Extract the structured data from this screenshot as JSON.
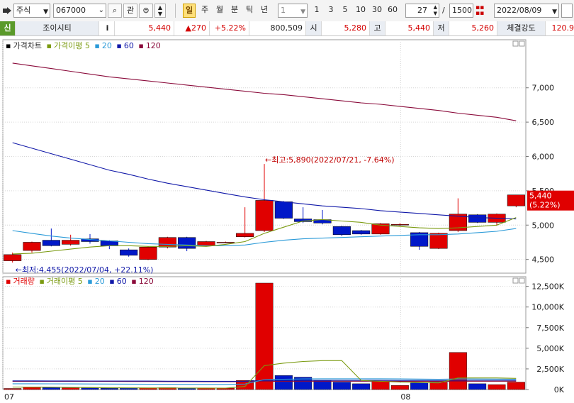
{
  "toolbar": {
    "market_select": "주식",
    "code_input": "067000",
    "btn_watch": "관",
    "period_buttons": [
      "일",
      "주",
      "월",
      "분",
      "틱",
      "년"
    ],
    "active_period": "일",
    "interval_select": "1",
    "intervals": [
      "1",
      "3",
      "5",
      "10",
      "30",
      "60"
    ],
    "count_current": "27",
    "count_sep": "/",
    "count_total": "1500",
    "date_input": "2022/08/09"
  },
  "quote": {
    "badge": "신",
    "name": "조이시티",
    "info_icon": "i",
    "price": "5,440",
    "change": "▲270",
    "change_pct": "+5.22%",
    "volume": "800,509",
    "open_label": "시",
    "open": "5,280",
    "high_label": "고",
    "high": "5,440",
    "low_label": "저",
    "low": "5,260",
    "strength_label": "체결강도",
    "strength": "120.9"
  },
  "colors": {
    "up": "#e00000",
    "down": "#0018c8",
    "ma5": "#7a9a10",
    "ma20": "#2a9ad8",
    "ma60": "#1018a8",
    "ma120": "#8a0a3a"
  },
  "chart_data": [
    {
      "type": "candlestick",
      "title": "가격차트",
      "legend": [
        "가격이평 5",
        "20",
        "60",
        "120"
      ],
      "x_tick_labels": [
        "07",
        "08"
      ],
      "ylim": [
        4300,
        7700
      ],
      "y_ticks": [
        "4,500",
        "5,000",
        "5,500",
        "6,000",
        "6,500",
        "7,000"
      ],
      "candles": [
        {
          "o": 4480,
          "c": 4570,
          "h": 4600,
          "l": 4455
        },
        {
          "o": 4630,
          "c": 4750,
          "h": 4760,
          "l": 4600
        },
        {
          "o": 4780,
          "c": 4700,
          "h": 4950,
          "l": 4690
        },
        {
          "o": 4720,
          "c": 4780,
          "h": 4860,
          "l": 4700
        },
        {
          "o": 4800,
          "c": 4760,
          "h": 4870,
          "l": 4730
        },
        {
          "o": 4770,
          "c": 4700,
          "h": 4780,
          "l": 4650
        },
        {
          "o": 4640,
          "c": 4560,
          "h": 4660,
          "l": 4540
        },
        {
          "o": 4500,
          "c": 4680,
          "h": 4690,
          "l": 4490
        },
        {
          "o": 4680,
          "c": 4820,
          "h": 4830,
          "l": 4660
        },
        {
          "o": 4820,
          "c": 4660,
          "h": 4830,
          "l": 4620
        },
        {
          "o": 4700,
          "c": 4760,
          "h": 4770,
          "l": 4690
        },
        {
          "o": 4750,
          "c": 4750,
          "h": 4760,
          "l": 4740
        },
        {
          "o": 4830,
          "c": 4880,
          "h": 5260,
          "l": 4820
        },
        {
          "o": 4920,
          "c": 5360,
          "h": 5890,
          "l": 4900
        },
        {
          "o": 5340,
          "c": 5100,
          "h": 5350,
          "l": 5090
        },
        {
          "o": 5090,
          "c": 5050,
          "h": 5260,
          "l": 5030
        },
        {
          "o": 5080,
          "c": 5030,
          "h": 5220,
          "l": 5010
        },
        {
          "o": 4980,
          "c": 4860,
          "h": 4990,
          "l": 4840
        },
        {
          "o": 4920,
          "c": 4870,
          "h": 4930,
          "l": 4860
        },
        {
          "o": 4870,
          "c": 5020,
          "h": 5030,
          "l": 4860
        },
        {
          "o": 5010,
          "c": 5010,
          "h": 5030,
          "l": 4990
        },
        {
          "o": 4890,
          "c": 4690,
          "h": 4900,
          "l": 4640
        },
        {
          "o": 4660,
          "c": 4880,
          "h": 4890,
          "l": 4650
        },
        {
          "o": 4920,
          "c": 5160,
          "h": 5390,
          "l": 4900
        },
        {
          "o": 5150,
          "c": 5040,
          "h": 5160,
          "l": 5030
        },
        {
          "o": 5040,
          "c": 5160,
          "h": 5170,
          "l": 4990
        },
        {
          "o": 5280,
          "c": 5440,
          "h": 5440,
          "l": 5260
        }
      ],
      "ma5": [
        4580,
        4590,
        4620,
        4650,
        4680,
        4700,
        4700,
        4690,
        4690,
        4700,
        4690,
        4720,
        4760,
        4880,
        4970,
        5060,
        5080,
        5060,
        5040,
        5000,
        4980,
        4960,
        4950,
        4960,
        4980,
        5000,
        5110
      ],
      "ma20": [
        4920,
        4880,
        4840,
        4810,
        4790,
        4770,
        4750,
        4730,
        4720,
        4710,
        4700,
        4700,
        4710,
        4750,
        4780,
        4800,
        4810,
        4820,
        4830,
        4840,
        4850,
        4860,
        4860,
        4870,
        4890,
        4910,
        4950
      ],
      "ma60": [
        6200,
        6120,
        6040,
        5960,
        5880,
        5800,
        5740,
        5670,
        5610,
        5560,
        5510,
        5460,
        5410,
        5370,
        5340,
        5310,
        5280,
        5260,
        5240,
        5210,
        5190,
        5170,
        5150,
        5130,
        5110,
        5100,
        5090
      ],
      "ma120": [
        7360,
        7320,
        7280,
        7240,
        7200,
        7160,
        7130,
        7100,
        7070,
        7040,
        7010,
        6980,
        6950,
        6920,
        6900,
        6870,
        6840,
        6810,
        6780,
        6760,
        6730,
        6700,
        6670,
        6630,
        6600,
        6570,
        6520
      ],
      "annotations": {
        "high": "←최고:5,890(2022/07/21, -7.64%)",
        "low": "←최저:4,455(2022/07/04, +22.11%)",
        "last_price": "5,440",
        "last_pct": "(5.22%)"
      }
    },
    {
      "type": "bar",
      "title": "거래량",
      "legend": [
        "거래이평 5",
        "20",
        "60",
        "120"
      ],
      "ylim": [
        0,
        13500
      ],
      "y_ticks": [
        "0K",
        "2,500K",
        "5,000K",
        "7,500K",
        "10,000K",
        "12,500K"
      ],
      "values": [
        130,
        320,
        240,
        210,
        180,
        160,
        180,
        200,
        220,
        140,
        150,
        170,
        1100,
        12900,
        1700,
        1500,
        1100,
        900,
        700,
        1000,
        500,
        800,
        900,
        4500,
        700,
        600,
        900
      ],
      "ma5": [
        300,
        290,
        280,
        260,
        240,
        210,
        200,
        190,
        190,
        180,
        180,
        170,
        370,
        2900,
        3200,
        3400,
        3500,
        3500,
        1100,
        1000,
        900,
        850,
        800,
        1400,
        1400,
        1400,
        1350
      ],
      "ma20": [
        700,
        700,
        690,
        680,
        670,
        660,
        650,
        640,
        640,
        630,
        620,
        620,
        660,
        1200,
        1250,
        1280,
        1300,
        1300,
        1300,
        1300,
        1280,
        1260,
        1250,
        1280,
        1270,
        1260,
        1250
      ],
      "ma60": [
        1050,
        1050,
        1040,
        1040,
        1030,
        1030,
        1020,
        1020,
        1010,
        1010,
        1000,
        1000,
        1010,
        1100,
        1100,
        1110,
        1110,
        1110,
        1110,
        1110,
        1100,
        1100,
        1100,
        1120,
        1120,
        1120,
        1110
      ],
      "ma120": [
        1000,
        1000,
        990,
        990,
        985,
        980,
        975,
        970,
        965,
        960,
        955,
        950,
        955,
        1000,
        1000,
        1005,
        1005,
        1005,
        1005,
        1005,
        1000,
        1000,
        1000,
        1010,
        1010,
        1010,
        1005
      ]
    }
  ]
}
